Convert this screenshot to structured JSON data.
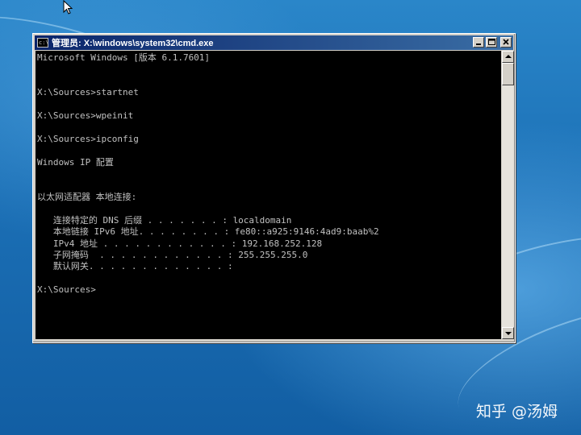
{
  "window": {
    "title": "管理员: X:\\windows\\system32\\cmd.exe",
    "buttons": {
      "minimize": "_",
      "maximize": "□",
      "close": "×"
    }
  },
  "console": {
    "lines": [
      "Microsoft Windows [版本 6.1.7601]",
      "",
      "",
      "X:\\Sources>startnet",
      "",
      "X:\\Sources>wpeinit",
      "",
      "X:\\Sources>ipconfig",
      "",
      "Windows IP 配置",
      "",
      "",
      "以太网适配器 本地连接:",
      "",
      "   连接特定的 DNS 后缀 . . . . . . . : localdomain",
      "   本地链接 IPv6 地址. . . . . . . . : fe80::a925:9146:4ad9:baab%2",
      "   IPv4 地址 . . . . . . . . . . . . : 192.168.252.128",
      "   子网掩码  . . . . . . . . . . . . : 255.255.255.0",
      "   默认网关. . . . . . . . . . . . . :",
      "",
      "X:\\Sources>"
    ]
  },
  "watermark": "知乎 @汤姆",
  "colors": {
    "console_bg": "#000000",
    "console_fg": "#c0c0c0",
    "titlebar_start": "#0a246a",
    "titlebar_end": "#3a6ea5"
  }
}
